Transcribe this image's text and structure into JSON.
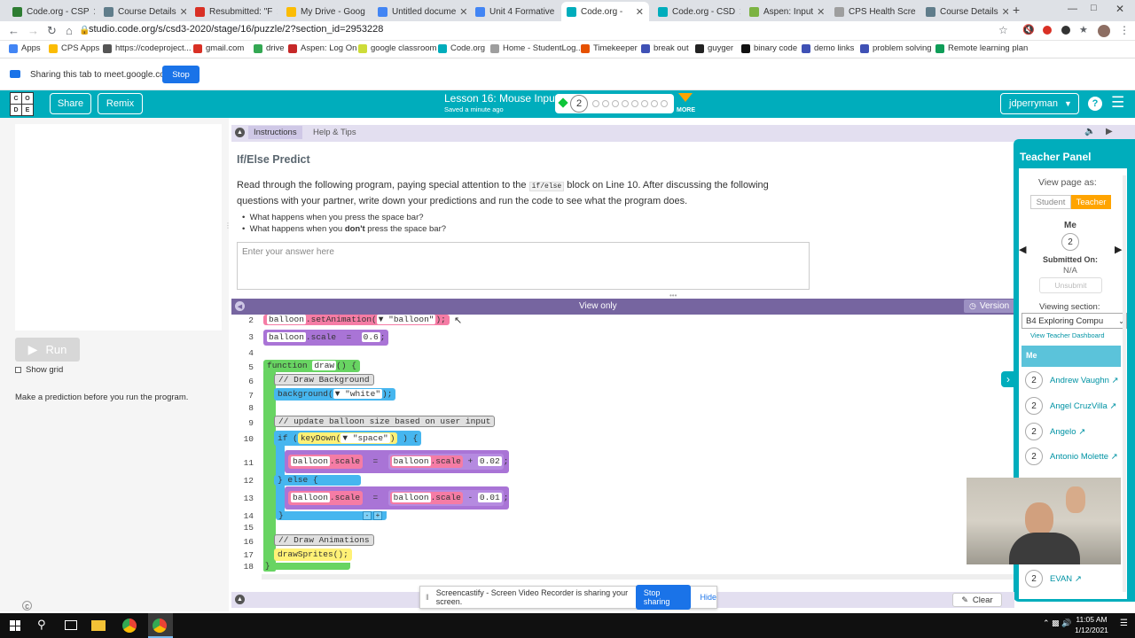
{
  "browser": {
    "tabs": [
      {
        "title": "Code.org - CSP",
        "color": "#2e7d32"
      },
      {
        "title": "Course Details",
        "color": "#607d8b"
      },
      {
        "title": "Resubmitted: \"F",
        "color": "#d93025"
      },
      {
        "title": "My Drive - Goog",
        "color": "#fbbc04"
      },
      {
        "title": "Untitled docume",
        "color": "#4285f4"
      },
      {
        "title": "Unit 4 Formative",
        "color": "#4285f4"
      },
      {
        "title": "Code.org -",
        "color": "#00adbc"
      },
      {
        "title": "Code.org - CSD",
        "color": "#00adbc"
      },
      {
        "title": "Aspen: Input",
        "color": "#7cb342"
      },
      {
        "title": "CPS Health Scre",
        "color": "#9e9e9e"
      },
      {
        "title": "Course Details",
        "color": "#607d8b"
      }
    ],
    "url": "studio.code.org/s/csd3-2020/stage/16/puzzle/2?section_id=2953228",
    "bookmarks": [
      "Apps",
      "CPS Apps",
      "https://codeproject...",
      "gmail.com",
      "drive",
      "Aspen: Log On",
      "google classroom",
      "Code.org",
      "Home - StudentLog...",
      "Timekeeper",
      "break out",
      "guyger",
      "binary code",
      "demo links",
      "problem solving",
      "Remote learning plan"
    ]
  },
  "sharebar": {
    "text": "Sharing this tab to meet.google.com",
    "stop_label": "Stop"
  },
  "header": {
    "logo_letters": [
      "C",
      "O",
      "D",
      "E"
    ],
    "share_label": "Share",
    "remix_label": "Remix",
    "lesson_title": "Lesson 16: Mouse Input",
    "saved_text": "Saved a minute ago",
    "current_level": "2",
    "more_label": "MORE",
    "user_label": "jdperryman",
    "help_glyph": "?"
  },
  "left": {
    "run_label": "Run",
    "show_grid_label": "Show grid",
    "prediction_text": "Make a prediction before you run the program."
  },
  "instructions": {
    "tab_instructions": "Instructions",
    "tab_help": "Help & Tips",
    "title": "If/Else Predict",
    "para_before": "Read through the following program, paying special attention to the ",
    "code_word": "if/else",
    "para_after": " block on Line 10. After discussing the following questions with your partner, write down your predictions and run the code to see what the program does.",
    "q1": "What happens when you press the space bar?",
    "q2_before": "What happens when you ",
    "q2_bold": "don't",
    "q2_after": " press the space bar?",
    "answer_placeholder": "Enter your answer here"
  },
  "code": {
    "view_only": "View only",
    "version_label": "Version",
    "line_numbers": [
      "2",
      "3",
      "4",
      "5",
      "6",
      "7",
      "8",
      "9",
      "10",
      "11",
      "12",
      "13",
      "14",
      "15",
      "16",
      "17",
      "18"
    ],
    "balloon": "balloon",
    "set_animation": ".setAnimation(",
    "balloon_str": "\"balloon\"",
    "close_semi": ");",
    "scale": ".scale",
    "eq": "=",
    "v06": "0.6",
    "semi": ";",
    "function_kw": "function",
    "draw_name": "draw",
    "fn_tail": "() {",
    "c_draw_bg": "// Draw Background",
    "background_call": "background(",
    "white_str": "\"white\"",
    "c_update": "// update balloon size based on user input",
    "if_kw": "if (",
    "keydown_call": "keyDown(",
    "space_str": "\"space\"",
    "if_tail": ") {",
    "plus": "+",
    "v002": "0.02",
    "else_kw": "} else {",
    "minus": "-",
    "v001": "0.01",
    "close_brace": "}",
    "c_draw_anim": "// Draw Animations",
    "draw_sprites": "drawSprites();",
    "dropdown_glyph": "▼"
  },
  "teacher_panel": {
    "title": "Teacher Panel",
    "view_as": "View page as:",
    "student_label": "Student",
    "teacher_label": "Teacher",
    "me_label": "Me",
    "me_level": "2",
    "submitted_on_label": "Submitted On:",
    "submitted_on_value": "N/A",
    "unsubmit_label": "Unsubmit",
    "viewing_section_label": "Viewing section:",
    "section_value": "B4 Exploring Compu",
    "dashboard_link": "View Teacher Dashboard",
    "me_row": "Me",
    "students": [
      {
        "name": "Andrew Vaughn",
        "level": "2"
      },
      {
        "name": "Angel CruzVilla",
        "level": "2"
      },
      {
        "name": "Angelo",
        "level": "2"
      },
      {
        "name": "Antonio Molette",
        "level": "2"
      },
      {
        "name": "EVAN",
        "level": "2"
      }
    ]
  },
  "bottom": {
    "clear_label": "Clear",
    "screencastify_text": "Screencastify - Screen Video Recorder is sharing your screen.",
    "stop_sharing_label": "Stop sharing",
    "hide_label": "Hide"
  },
  "taskbar": {
    "time": "11:05 AM",
    "date": "1/12/2021"
  },
  "colors": {
    "teal": "#00adbc",
    "purple": "#7665a0",
    "stop_blue": "#1a73e8"
  }
}
